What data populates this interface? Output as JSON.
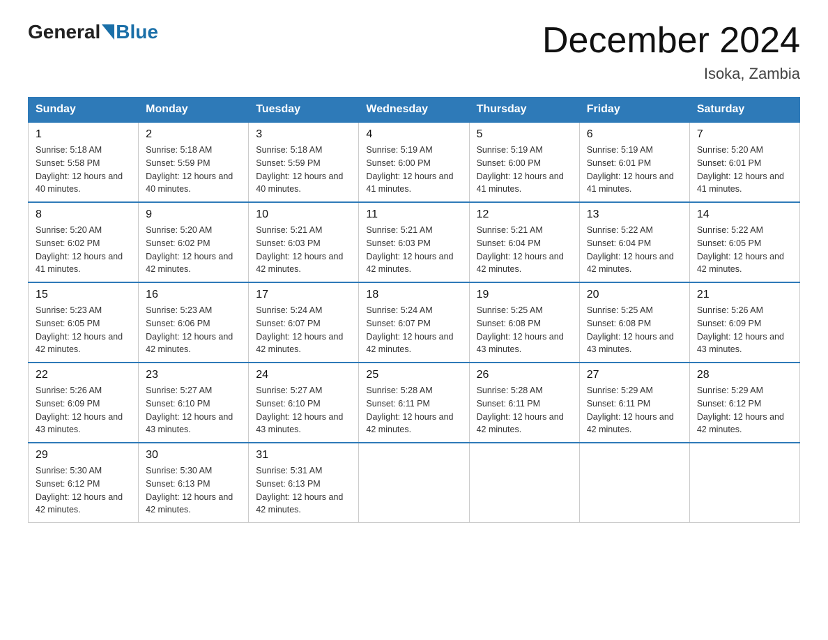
{
  "header": {
    "logo_general": "General",
    "logo_blue": "Blue",
    "month_title": "December 2024",
    "location": "Isoka, Zambia"
  },
  "columns": [
    "Sunday",
    "Monday",
    "Tuesday",
    "Wednesday",
    "Thursday",
    "Friday",
    "Saturday"
  ],
  "weeks": [
    [
      {
        "day": "1",
        "sunrise": "5:18 AM",
        "sunset": "5:58 PM",
        "daylight": "12 hours and 40 minutes."
      },
      {
        "day": "2",
        "sunrise": "5:18 AM",
        "sunset": "5:59 PM",
        "daylight": "12 hours and 40 minutes."
      },
      {
        "day": "3",
        "sunrise": "5:18 AM",
        "sunset": "5:59 PM",
        "daylight": "12 hours and 40 minutes."
      },
      {
        "day": "4",
        "sunrise": "5:19 AM",
        "sunset": "6:00 PM",
        "daylight": "12 hours and 41 minutes."
      },
      {
        "day": "5",
        "sunrise": "5:19 AM",
        "sunset": "6:00 PM",
        "daylight": "12 hours and 41 minutes."
      },
      {
        "day": "6",
        "sunrise": "5:19 AM",
        "sunset": "6:01 PM",
        "daylight": "12 hours and 41 minutes."
      },
      {
        "day": "7",
        "sunrise": "5:20 AM",
        "sunset": "6:01 PM",
        "daylight": "12 hours and 41 minutes."
      }
    ],
    [
      {
        "day": "8",
        "sunrise": "5:20 AM",
        "sunset": "6:02 PM",
        "daylight": "12 hours and 41 minutes."
      },
      {
        "day": "9",
        "sunrise": "5:20 AM",
        "sunset": "6:02 PM",
        "daylight": "12 hours and 42 minutes."
      },
      {
        "day": "10",
        "sunrise": "5:21 AM",
        "sunset": "6:03 PM",
        "daylight": "12 hours and 42 minutes."
      },
      {
        "day": "11",
        "sunrise": "5:21 AM",
        "sunset": "6:03 PM",
        "daylight": "12 hours and 42 minutes."
      },
      {
        "day": "12",
        "sunrise": "5:21 AM",
        "sunset": "6:04 PM",
        "daylight": "12 hours and 42 minutes."
      },
      {
        "day": "13",
        "sunrise": "5:22 AM",
        "sunset": "6:04 PM",
        "daylight": "12 hours and 42 minutes."
      },
      {
        "day": "14",
        "sunrise": "5:22 AM",
        "sunset": "6:05 PM",
        "daylight": "12 hours and 42 minutes."
      }
    ],
    [
      {
        "day": "15",
        "sunrise": "5:23 AM",
        "sunset": "6:05 PM",
        "daylight": "12 hours and 42 minutes."
      },
      {
        "day": "16",
        "sunrise": "5:23 AM",
        "sunset": "6:06 PM",
        "daylight": "12 hours and 42 minutes."
      },
      {
        "day": "17",
        "sunrise": "5:24 AM",
        "sunset": "6:07 PM",
        "daylight": "12 hours and 42 minutes."
      },
      {
        "day": "18",
        "sunrise": "5:24 AM",
        "sunset": "6:07 PM",
        "daylight": "12 hours and 42 minutes."
      },
      {
        "day": "19",
        "sunrise": "5:25 AM",
        "sunset": "6:08 PM",
        "daylight": "12 hours and 43 minutes."
      },
      {
        "day": "20",
        "sunrise": "5:25 AM",
        "sunset": "6:08 PM",
        "daylight": "12 hours and 43 minutes."
      },
      {
        "day": "21",
        "sunrise": "5:26 AM",
        "sunset": "6:09 PM",
        "daylight": "12 hours and 43 minutes."
      }
    ],
    [
      {
        "day": "22",
        "sunrise": "5:26 AM",
        "sunset": "6:09 PM",
        "daylight": "12 hours and 43 minutes."
      },
      {
        "day": "23",
        "sunrise": "5:27 AM",
        "sunset": "6:10 PM",
        "daylight": "12 hours and 43 minutes."
      },
      {
        "day": "24",
        "sunrise": "5:27 AM",
        "sunset": "6:10 PM",
        "daylight": "12 hours and 43 minutes."
      },
      {
        "day": "25",
        "sunrise": "5:28 AM",
        "sunset": "6:11 PM",
        "daylight": "12 hours and 42 minutes."
      },
      {
        "day": "26",
        "sunrise": "5:28 AM",
        "sunset": "6:11 PM",
        "daylight": "12 hours and 42 minutes."
      },
      {
        "day": "27",
        "sunrise": "5:29 AM",
        "sunset": "6:11 PM",
        "daylight": "12 hours and 42 minutes."
      },
      {
        "day": "28",
        "sunrise": "5:29 AM",
        "sunset": "6:12 PM",
        "daylight": "12 hours and 42 minutes."
      }
    ],
    [
      {
        "day": "29",
        "sunrise": "5:30 AM",
        "sunset": "6:12 PM",
        "daylight": "12 hours and 42 minutes."
      },
      {
        "day": "30",
        "sunrise": "5:30 AM",
        "sunset": "6:13 PM",
        "daylight": "12 hours and 42 minutes."
      },
      {
        "day": "31",
        "sunrise": "5:31 AM",
        "sunset": "6:13 PM",
        "daylight": "12 hours and 42 minutes."
      },
      null,
      null,
      null,
      null
    ]
  ]
}
